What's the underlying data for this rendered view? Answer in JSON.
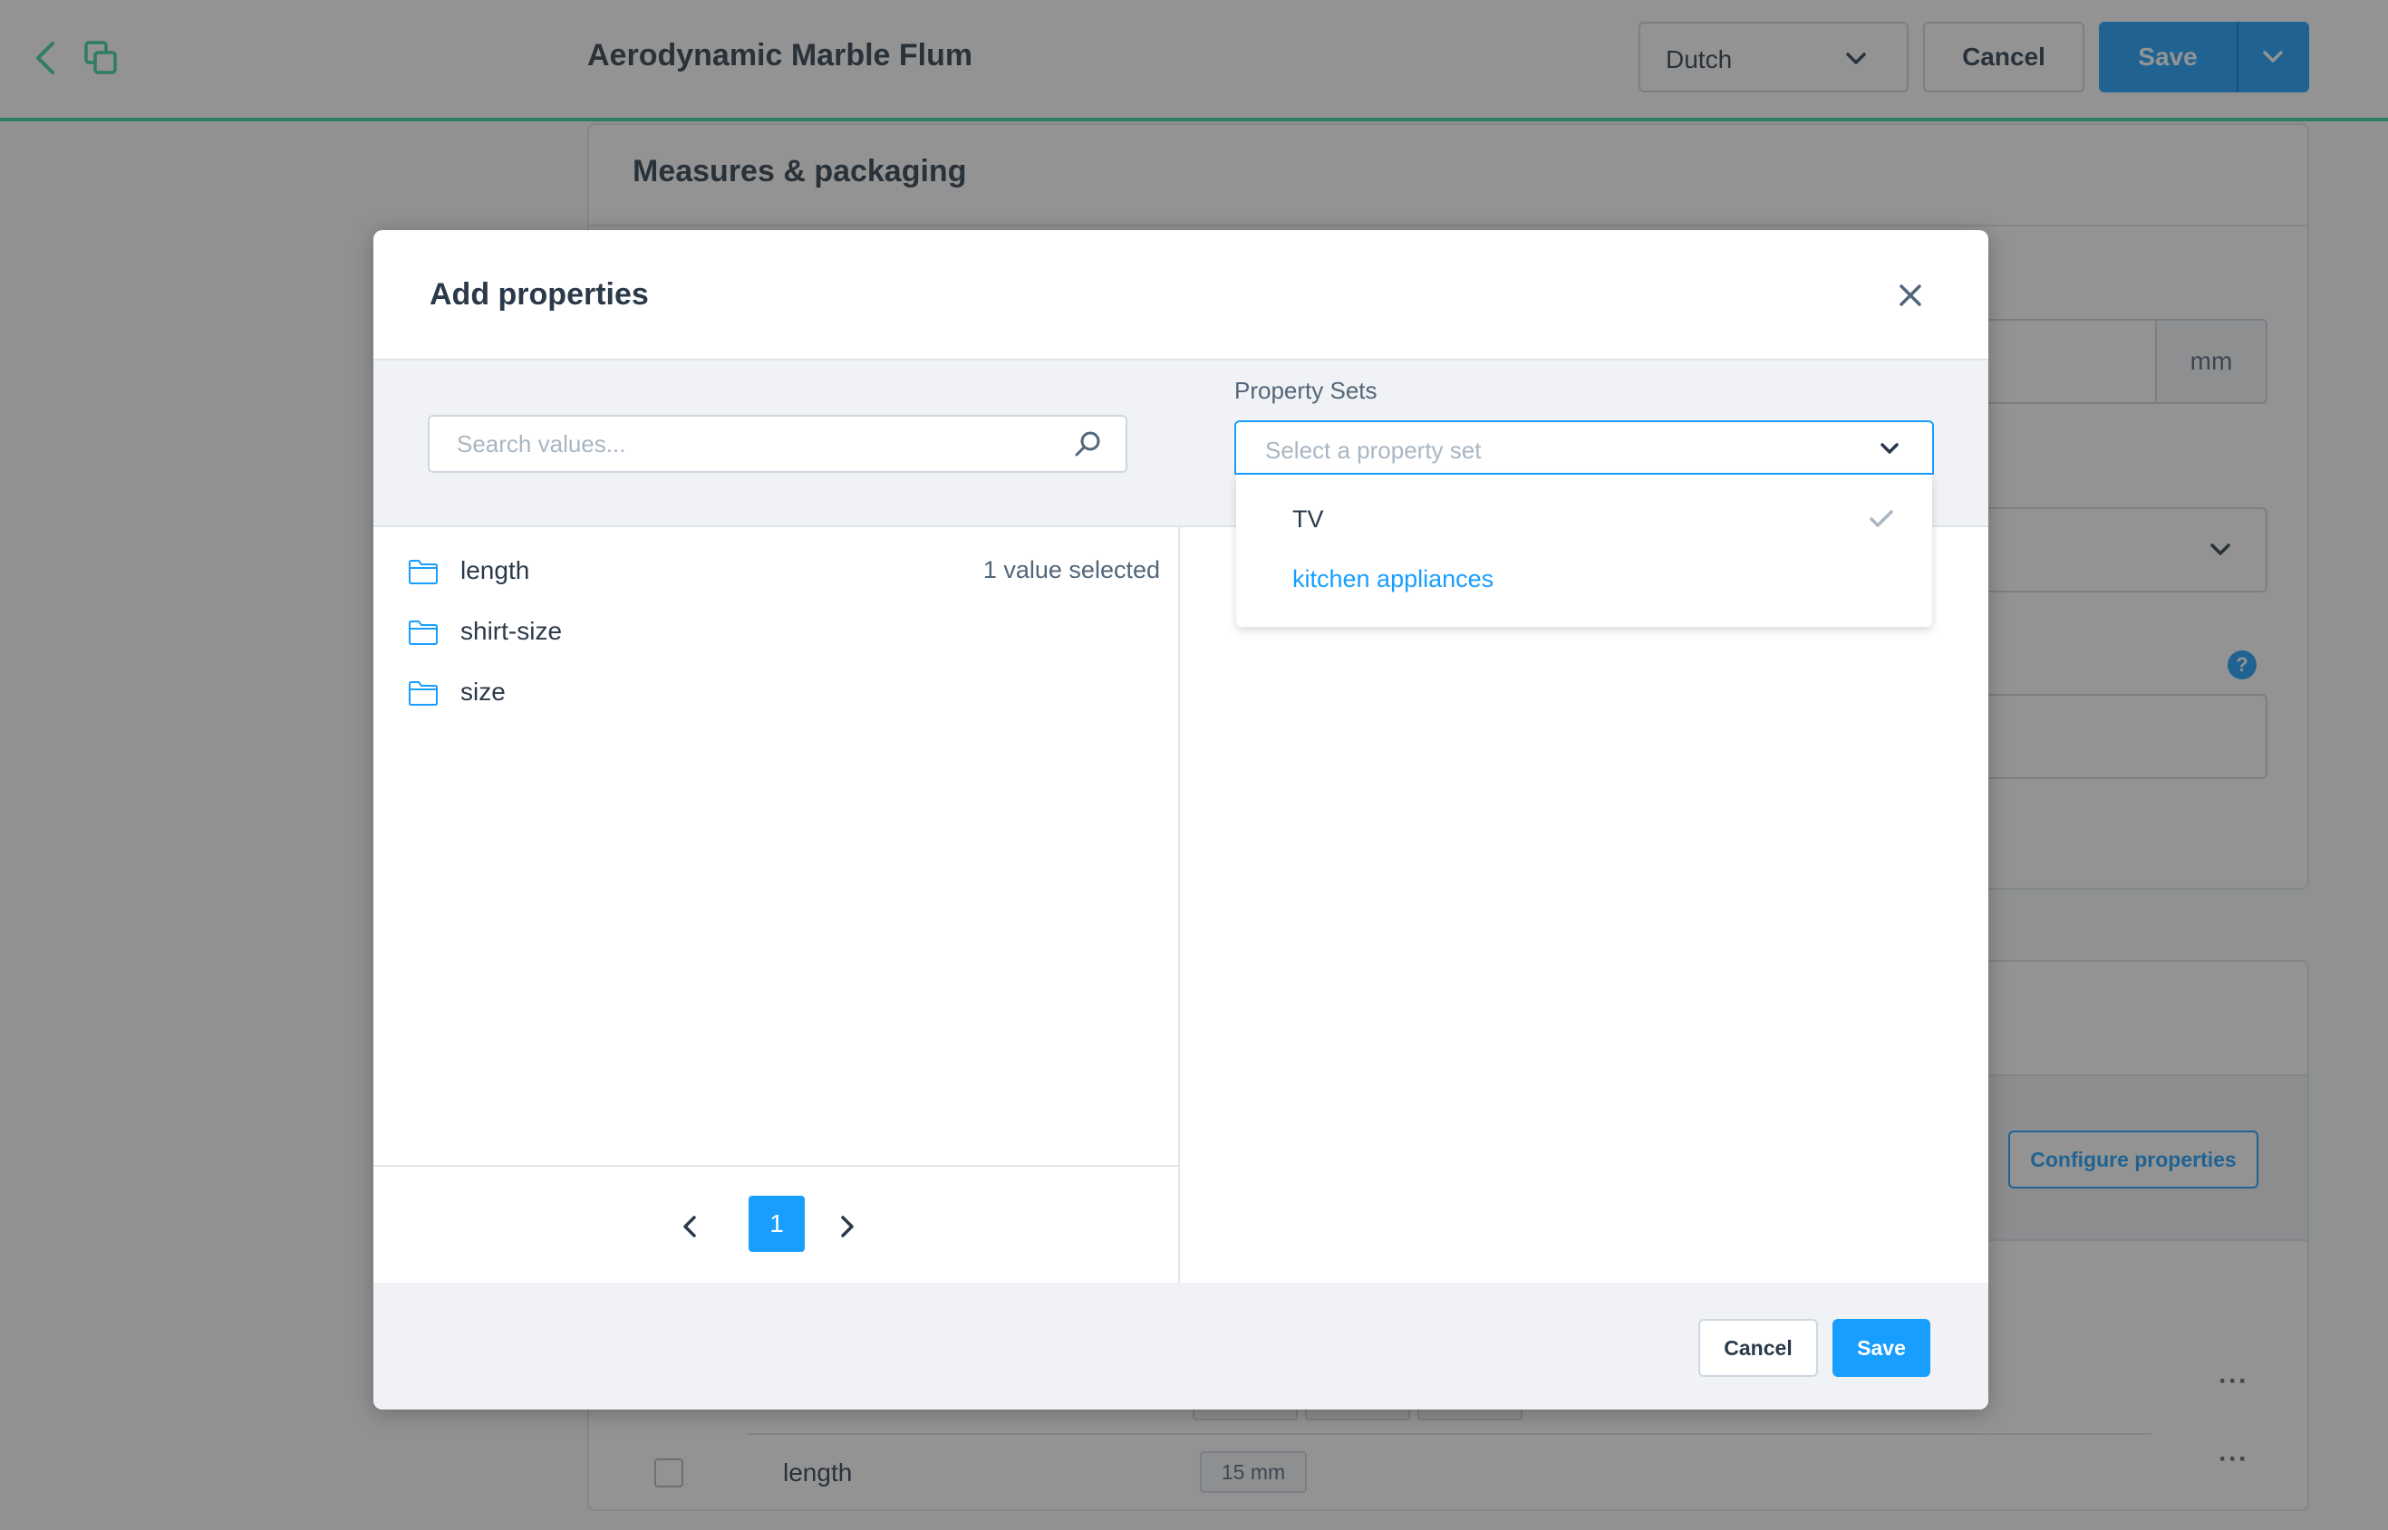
{
  "topbar": {
    "title": "Aerodynamic Marble Flum",
    "language": "Dutch",
    "cancel_label": "Cancel",
    "save_label": "Save"
  },
  "background": {
    "measures_card_title": "Measures & packaging",
    "unit": "mm",
    "help_badge": "?",
    "configure_label": "Configure properties",
    "row": {
      "name": "length",
      "value": "15 mm"
    }
  },
  "modal": {
    "title": "Add properties",
    "search": {
      "placeholder": "Search values..."
    },
    "property_sets": {
      "label": "Property Sets",
      "placeholder": "Select a property set",
      "options": [
        {
          "label": "TV",
          "checked": true
        },
        {
          "label": "kitchen appliances",
          "checked": false
        }
      ]
    },
    "properties": [
      {
        "name": "length",
        "selected_text": "1 value selected"
      },
      {
        "name": "shirt-size",
        "selected_text": ""
      },
      {
        "name": "size",
        "selected_text": ""
      }
    ],
    "pagination": {
      "current_page": "1"
    },
    "footer": {
      "cancel_label": "Cancel",
      "save_label": "Save"
    }
  },
  "colors": {
    "primary": "#189eff",
    "accent_green": "#37d398",
    "text_dark": "#2b3a4a",
    "text_muted": "#52667a"
  },
  "icons": {
    "back": "arrow-left-icon",
    "duplicate": "duplicate-icon",
    "close": "close-icon",
    "search": "search-icon",
    "folder": "folder-icon",
    "check": "checkmark-icon",
    "chevron": "chevron-down-icon"
  }
}
